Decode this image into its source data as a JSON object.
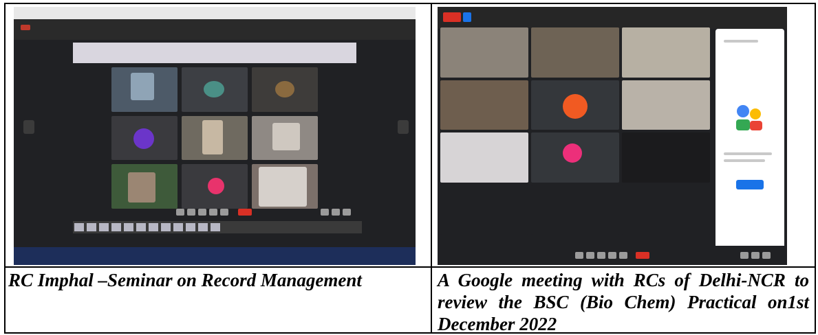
{
  "captions": {
    "left": "RC Imphal –Seminar on Record Management",
    "right": "A Google meeting with RCs of Delhi-NCR to review the BSC (Bio Chem) Practical on1st December 2022"
  },
  "images": {
    "left": {
      "icons": [
        "video-tile",
        "participant-avatar-icon",
        "microphone-icon",
        "end-call-icon"
      ],
      "colors": {
        "background": "#202124",
        "end_call": "#d93025",
        "taskbar": "#1d2e5a"
      }
    },
    "right": {
      "icons": [
        "video-tile",
        "participant-avatar-icon",
        "end-call-icon",
        "side-panel-illustration"
      ],
      "colors": {
        "background": "#202124",
        "end_call": "#d93025",
        "panel_button": "#1a73e8"
      }
    }
  }
}
